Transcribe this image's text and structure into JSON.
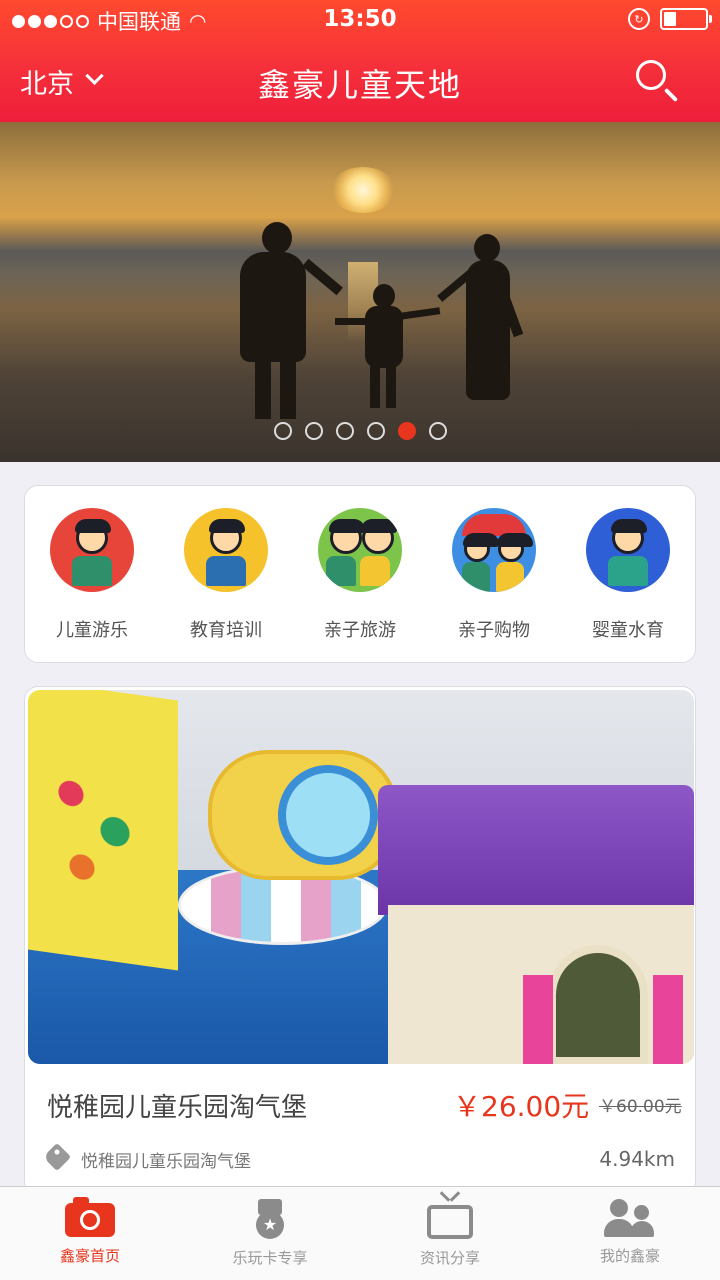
{
  "status_bar": {
    "carrier": "中国联通",
    "time": "13:50"
  },
  "nav": {
    "city": "北京",
    "title": "鑫豪儿童天地"
  },
  "banner": {
    "page_count": 6,
    "active_page": 5
  },
  "categories": [
    {
      "label": "儿童游乐",
      "icon": "kids-play-icon",
      "color": "#e8453a"
    },
    {
      "label": "教育培训",
      "icon": "education-icon",
      "color": "#f5c22c"
    },
    {
      "label": "亲子旅游",
      "icon": "family-travel-icon",
      "color": "#7dc44b"
    },
    {
      "label": "亲子购物",
      "icon": "family-shopping-icon",
      "color": "#3e8fe3"
    },
    {
      "label": "婴童水育",
      "icon": "baby-swim-icon",
      "color": "#2f5fd6"
    }
  ],
  "product": {
    "name": "悦稚园儿童乐园淘气堡",
    "price": "￥26.00元",
    "original_price": "￥60.00元",
    "shop": "悦稚园儿童乐园淘气堡",
    "distance": "4.94km"
  },
  "tabs": [
    {
      "label": "鑫豪首页",
      "icon": "camera-icon",
      "active": true
    },
    {
      "label": "乐玩卡专享",
      "icon": "medal-icon",
      "active": false
    },
    {
      "label": "资讯分享",
      "icon": "tv-icon",
      "active": false
    },
    {
      "label": "我的鑫豪",
      "icon": "users-icon",
      "active": false
    }
  ],
  "colors": {
    "brand": "#f5303a",
    "accent": "#e8361e"
  }
}
